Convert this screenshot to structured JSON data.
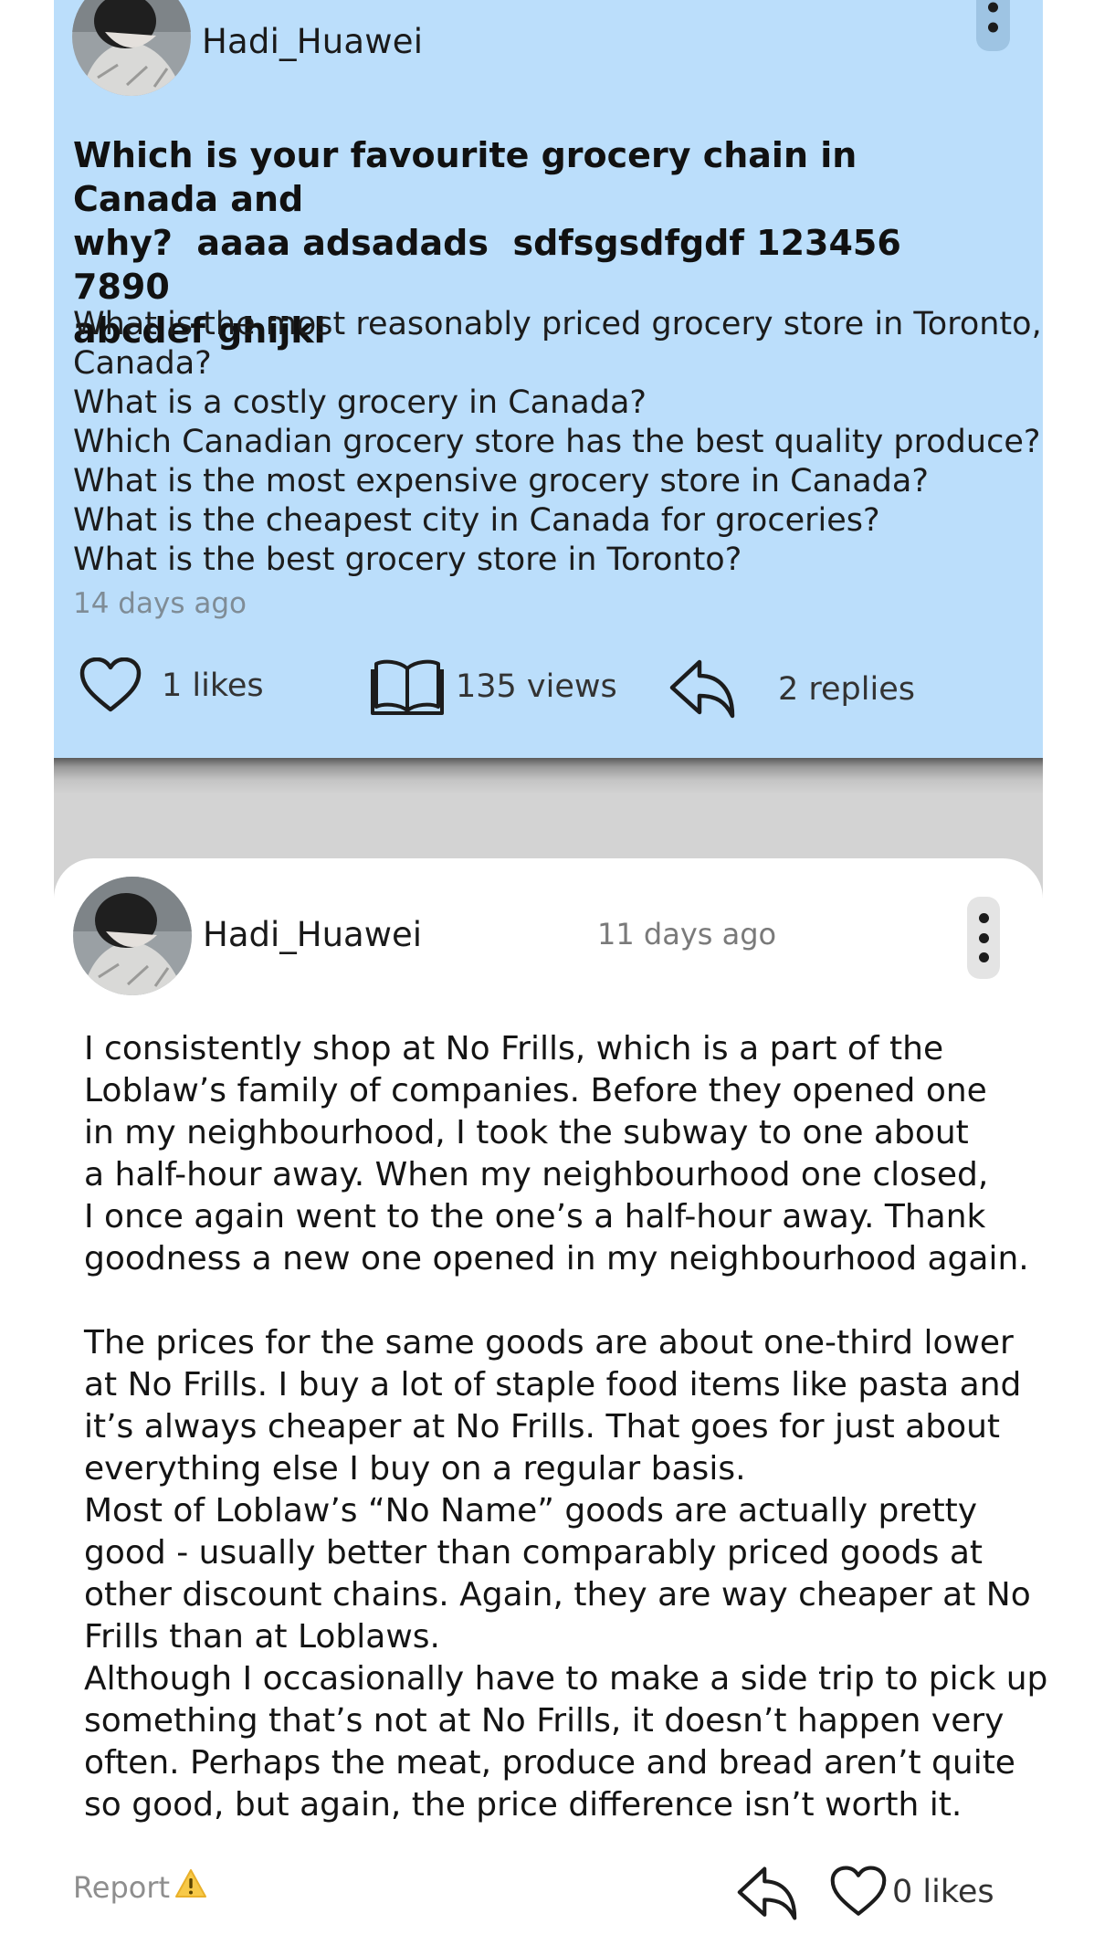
{
  "question": {
    "author": "Hadi_Huawei",
    "title": "Which is your favourite grocery chain in Canada and\nwhy?  aaaa adsadads  sdfsgsdfgdf 123456  7890\nabcdef ghijkl",
    "lines": [
      "What is the most reasonably priced grocery store in Toronto,",
      "Canada?",
      "What is a costly grocery in Canada?",
      "Which Canadian grocery store has the best quality produce?",
      "What is the most expensive grocery store in Canada?",
      "What is the cheapest city in Canada for groceries?",
      "What is the best grocery store in Toronto?"
    ],
    "time": "14 days ago",
    "likes_label": "1 likes",
    "views_label": "135 views",
    "replies_label": "2 replies",
    "icons": {
      "like": "heart-outline-icon",
      "views": "open-book-icon",
      "replies": "reply-arrow-icon",
      "menu": "more-vertical-icon"
    }
  },
  "reply": {
    "author": "Hadi_Huawei",
    "time": "11 days ago",
    "body_lines": [
      "I consistently shop at No Frills, which is a part of the",
      "Loblaw’s family of companies. Before they opened one",
      "in my neighbourhood, I took the subway to one about",
      "a half-hour away. When my neighbourhood one closed,",
      "I once again went to the one’s a half-hour away. Thank",
      "goodness a new one opened in my neighbourhood again.",
      "",
      "The prices for the same goods are about one-third lower",
      "at No Frills. I buy a lot of staple food items like pasta and",
      "it’s always cheaper at No Frills. That goes for just about",
      "everything else I buy on a regular basis.",
      "Most of Loblaw’s “No Name” goods are actually pretty",
      "good - usually better than comparably priced goods at",
      "other discount chains. Again, they are way cheaper at No",
      "Frills than at Loblaws.",
      "Although I occasionally have to make a side trip to pick up",
      "something that’s not at No Frills, it doesn’t happen very",
      "often. Perhaps the meat, produce and bread aren’t quite",
      "so good, but again, the price difference isn’t worth it."
    ],
    "report_label": "Report",
    "report_icon_glyph": "⚠️",
    "likes_label": "0 likes",
    "icons": {
      "report": "warning-icon",
      "reply": "reply-arrow-icon",
      "like": "heart-outline-icon",
      "menu": "more-vertical-icon"
    }
  },
  "colors": {
    "question_bg": "#bbdefb",
    "separator_bg": "#d3d3d3",
    "muted_text": "#7f8c96"
  }
}
